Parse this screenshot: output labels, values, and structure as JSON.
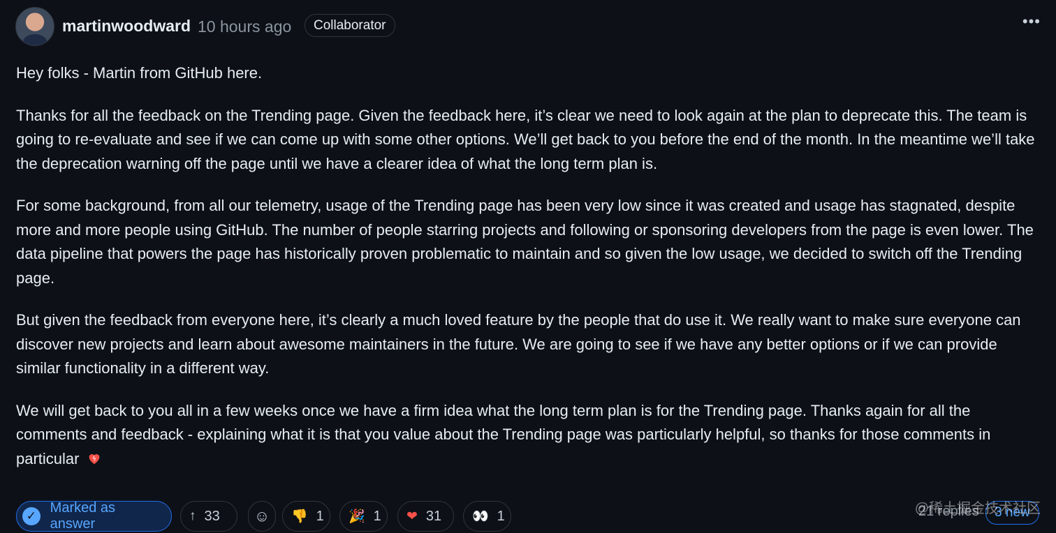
{
  "post": {
    "author": "martinwoodward",
    "time": "10 hours ago",
    "badge": "Collaborator",
    "menu_icon": "kebab-horizontal-icon",
    "paragraphs": [
      "Hey folks - Martin from GitHub here.",
      "Thanks for all the feedback on the Trending page. Given the feedback here, it’s clear we need to look again at the plan to deprecate this. The team is going to re-evaluate and see if we can come up with some other options. We’ll get back to you before the end of the month. In the meantime we’ll take the deprecation warning off the page until we have a clearer idea of what the long term plan is.",
      "For some background, from all our telemetry, usage of the Trending page has been very low since it was created and usage has stagnated, despite more and more people using GitHub. The number of people starring projects and following or sponsoring developers from the page is even lower. The data pipeline that powers the page has historically proven problematic to maintain and so given the low usage, we decided to switch off the Trending page.",
      "But given the feedback from everyone here, it’s clearly a much loved feature by the people that do use it. We really want to make sure everyone can discover new projects and learn about awesome maintainers in the future. We are going to see if we have any better options or if we can provide similar functionality in a different way.",
      "We will get back to you all in a few weeks once we have a firm idea what the long term plan is for the Trending page. Thanks again for all the comments and feedback - explaining what it is that you value about the Trending page was particularly helpful, so thanks for those comments in particular"
    ]
  },
  "footer": {
    "answer_label": "Marked as answer",
    "upvotes": "33",
    "reactions": [
      {
        "icon": "thumbs-down-icon",
        "glyph": "👎",
        "count": "1"
      },
      {
        "icon": "tada-icon",
        "glyph": "🎉",
        "count": "1"
      },
      {
        "icon": "heart-icon",
        "glyph": "❤",
        "count": "31"
      },
      {
        "icon": "eyes-icon",
        "glyph": "👀",
        "count": "1"
      }
    ],
    "replies": "21 replies",
    "new_label": "3 new"
  },
  "watermark": "@稀土掘金技术社区",
  "colors": {
    "background": "#0d1117",
    "accent": "#58a6ff",
    "heart": "#f85149"
  }
}
